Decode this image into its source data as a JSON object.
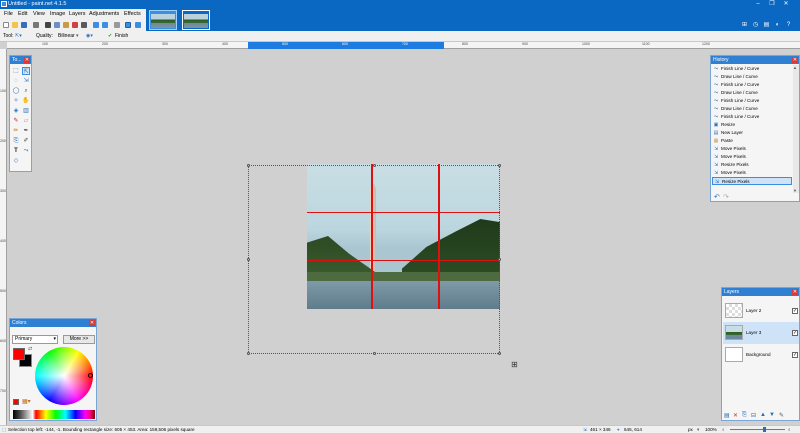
{
  "titlebar": {
    "title": "Untitled - paint.net 4.1.5"
  },
  "menu": {
    "items": [
      "File",
      "Edit",
      "View",
      "Image",
      "Layers",
      "Adjustments",
      "Effects"
    ]
  },
  "tool_options": {
    "tool_label": "Tool:",
    "quality_label": "Quality:",
    "quality_value": "Bilinear",
    "finish_label": "Finish"
  },
  "rulers": {
    "h_ticks": [
      "100",
      "200",
      "300",
      "400",
      "500",
      "600",
      "700",
      "800",
      "900",
      "1000",
      "1100",
      "1200"
    ],
    "v_ticks": [
      "100",
      "200",
      "300",
      "400",
      "500",
      "600",
      "700"
    ]
  },
  "tools_panel": {
    "title": "To..."
  },
  "history": {
    "title": "History",
    "items": [
      "Finish Line / Curve",
      "Draw Line / Curve",
      "Finish Line / Curve",
      "Draw Line / Curve",
      "Finish Line / Curve",
      "Draw Line / Curve",
      "Finish Line / Curve",
      "Resize",
      "New Layer",
      "Paste",
      "Move Pixels",
      "Move Pixels",
      "Resize Pixels",
      "Move Pixels",
      "Resize Pixels"
    ]
  },
  "layers": {
    "title": "Layers",
    "rows": [
      {
        "name": "Layer 2",
        "visible": true
      },
      {
        "name": "Layer 3",
        "visible": true
      },
      {
        "name": "Background",
        "visible": true
      }
    ]
  },
  "colors": {
    "title": "Colors",
    "mode": "Primary",
    "more_label": "More >>",
    "primary": "#ff0000",
    "secondary": "#000000"
  },
  "status": {
    "selection": "Selection top left: -144, -1. Bounding rectangle size: 605 × 453. Area: 159,506 pixels square",
    "size": "461 × 346",
    "cursor": "645, 614",
    "units": "px",
    "zoom": "100%"
  },
  "theme": {
    "accent": "#0a68c2",
    "guide_line": "#e01010"
  }
}
